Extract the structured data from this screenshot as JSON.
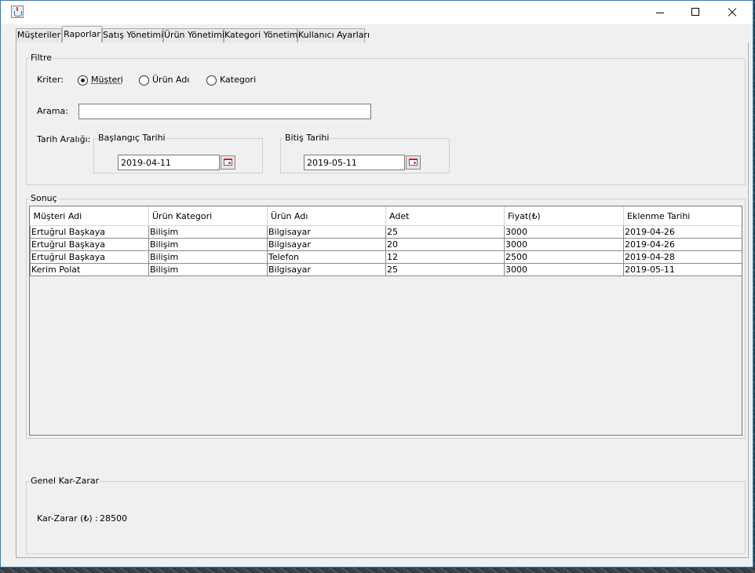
{
  "tabs": [
    {
      "label": "Müşteriler"
    },
    {
      "label": "Raporlar"
    },
    {
      "label": "Satış Yönetimi"
    },
    {
      "label": "Ürün Yönetimi"
    },
    {
      "label": "Kategori Yönetimi"
    },
    {
      "label": "Kullanıcı Ayarları"
    }
  ],
  "active_tab": "Raporlar",
  "filter": {
    "title": "Filtre",
    "criteria_label": "Kriter:",
    "options": [
      {
        "label": "Müşteri",
        "selected": true
      },
      {
        "label": "Ürün Adı",
        "selected": false
      },
      {
        "label": "Kategori",
        "selected": false
      }
    ],
    "search_label": "Arama:",
    "search_value": "",
    "date_range_label": "Tarih Aralığı:",
    "start": {
      "title": "Başlangıç Tarihi",
      "value": "2019-04-11"
    },
    "end": {
      "title": "Bitiş Tarihi",
      "value": "2019-05-11"
    }
  },
  "result": {
    "title": "Sonuç",
    "columns": [
      "Müşteri Adi",
      "Ürün Kategori",
      "Ürün Adı",
      "Adet",
      "Fiyat(₺)",
      "Eklenme Tarihi"
    ],
    "rows": [
      [
        "Ertuğrul Başkaya",
        "Bilişim",
        "Bilgisayar",
        "25",
        "3000",
        "2019-04-26"
      ],
      [
        "Ertuğrul Başkaya",
        "Bilişim",
        "Bilgisayar",
        "20",
        "3000",
        "2019-04-26"
      ],
      [
        "Ertuğrul Başkaya",
        "Bilişim",
        "Telefon",
        "12",
        "2500",
        "2019-04-28"
      ],
      [
        "Kerim Polat",
        "Bilişim",
        "Bilgisayar",
        "25",
        "3000",
        "2019-05-11"
      ]
    ]
  },
  "summary": {
    "title": "Genel Kar-Zarar",
    "label": "Kar-Zarar (₺) :",
    "value": "28500"
  },
  "colors": {
    "window_border": "#1883d7",
    "panel_bg": "#f0f0f0"
  }
}
